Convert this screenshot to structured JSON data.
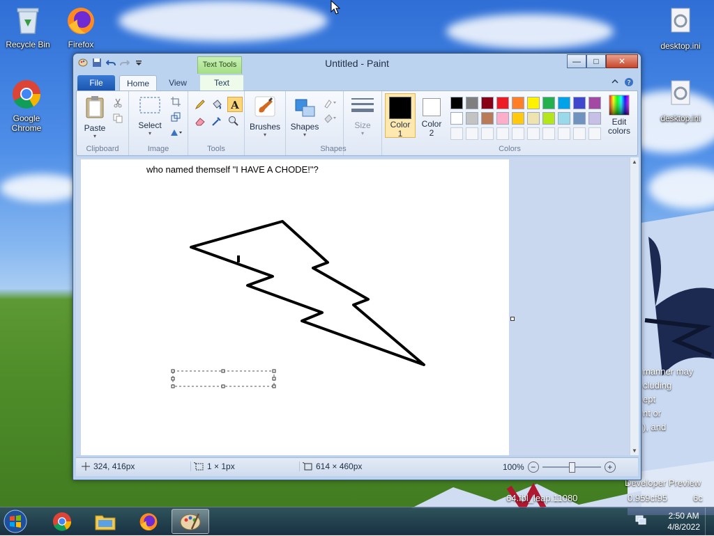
{
  "desktop": {
    "icons": [
      {
        "name": "recycle-bin",
        "label": "Recycle Bin"
      },
      {
        "name": "firefox",
        "label": "Firefox"
      },
      {
        "name": "google-chrome",
        "label": "Google\nChrome"
      },
      {
        "name": "desktop-ini-1",
        "label": "desktop.ini"
      },
      {
        "name": "desktop-ini-2",
        "label": "desktop.ini"
      }
    ],
    "fragments": [
      "manner may",
      "cluding",
      "ept",
      "nt or",
      "), and",
      "Developer Preview",
      "64.fbl_leap.11080",
      "0.959cf95",
      "6c"
    ]
  },
  "window": {
    "title": "Untitled - Paint",
    "context_tab": "Text Tools",
    "tabs": [
      "File",
      "Home",
      "View",
      "Text"
    ],
    "buttons": {
      "minimize": "—",
      "maximize": "□",
      "close": "✕"
    }
  },
  "ribbon": {
    "clipboard": {
      "label": "Clipboard",
      "paste": "Paste"
    },
    "image": {
      "label": "Image",
      "select": "Select"
    },
    "tools": {
      "label": "Tools"
    },
    "brushes": {
      "label": "Brushes"
    },
    "shapes": {
      "label": "Shapes",
      "shapes_btn": "Shapes",
      "size": "Size"
    },
    "colors": {
      "label": "Colors",
      "color1": "Color\n1",
      "color2": "Color\n2",
      "edit": "Edit\ncolors",
      "color1_value": "#000000",
      "color2_value": "#ffffff",
      "palette_row1": [
        "#000000",
        "#7f7f7f",
        "#880015",
        "#ed1c24",
        "#ff7f27",
        "#fff200",
        "#22b14c",
        "#00a2e8",
        "#3f48cc",
        "#a349a4"
      ],
      "palette_row2": [
        "#ffffff",
        "#c3c3c3",
        "#b97a57",
        "#ffaec9",
        "#ffc90e",
        "#efe4b0",
        "#b5e61d",
        "#99d9ea",
        "#7092be",
        "#c8bfe7"
      ]
    }
  },
  "canvas": {
    "text": "who named themself \"I HAVE A CHODE!\"?"
  },
  "status": {
    "cursor_pos": "324, 416px",
    "selection_size": "1 × 1px",
    "image_size": "614 × 460px",
    "zoom": "100%",
    "zoom_minus": "−",
    "zoom_plus": "+"
  },
  "clock": {
    "time": "2:50 AM",
    "date": "4/8/2022"
  }
}
